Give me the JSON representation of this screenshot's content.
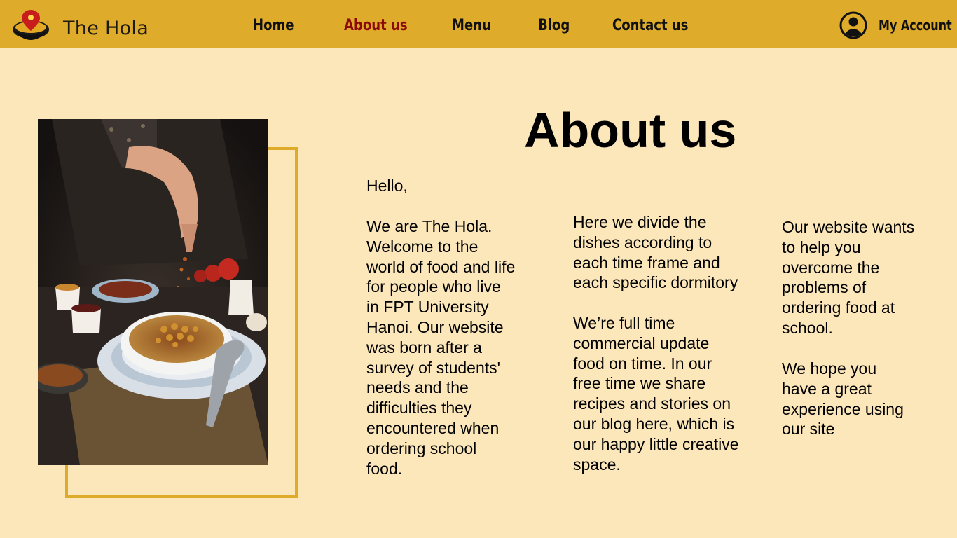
{
  "header": {
    "brand": "The Hola",
    "nav": [
      {
        "label": "Home",
        "active": false
      },
      {
        "label": "About us",
        "active": true
      },
      {
        "label": "Menu",
        "active": false
      },
      {
        "label": "Blog",
        "active": false
      },
      {
        "label": "Contact us",
        "active": false
      }
    ],
    "account_label": "My Account"
  },
  "main": {
    "title": "About us",
    "greeting": "Hello,",
    "column1": "We are The Hola.\nWelcome to the\nworld of food and life\nfor people who live\nin FPT University\nHanoi. Our website\nwas born after a\nsurvey of students'\nneeds and the\ndifficulties they\nencountered when\nordering school\nfood.",
    "column2_p1": "Here we divide the\ndishes according to\neach time frame and\neach specific dormitory",
    "column2_p2": "We’re full time\ncommercial update\nfood on time. In our\nfree time we share\nrecipes and stories on\nour blog here, which is\nour happy little creative\nspace.",
    "column3_p1": "Our website wants\nto help you\novercome the\nproblems of\nordering food at\nschool.",
    "column3_p2": " We hope you\nhave a great\nexperience using\nour site"
  },
  "colors": {
    "header_bg": "#dfab2b",
    "page_bg": "#fce7bb",
    "active_nav": "#8b0a0a",
    "frame": "#dfab2b"
  },
  "icons": {
    "logo": "bowl-logo-icon",
    "account": "user-circle-icon"
  }
}
